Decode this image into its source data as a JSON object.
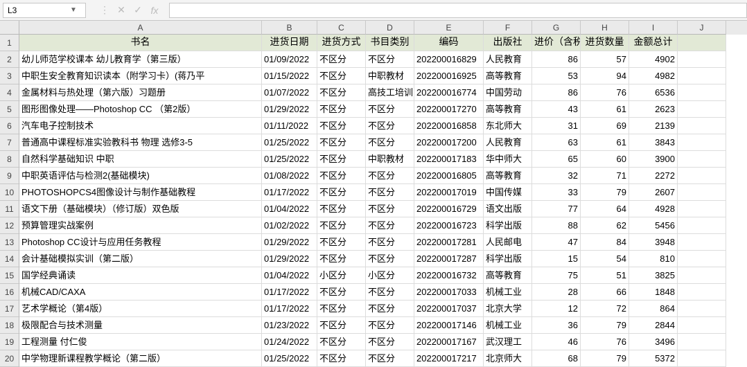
{
  "nameBox": "L3",
  "fxValue": "",
  "columns": [
    "A",
    "B",
    "C",
    "D",
    "E",
    "F",
    "G",
    "H",
    "I",
    "J"
  ],
  "rowNums": [
    "1",
    "2",
    "3",
    "4",
    "5",
    "6",
    "7",
    "8",
    "9",
    "10",
    "11",
    "12",
    "13",
    "14",
    "15",
    "16",
    "17",
    "18",
    "19",
    "20"
  ],
  "headerRow": [
    "书名",
    "进货日期",
    "进货方式",
    "书目类别",
    "编码",
    "出版社",
    "进价（含税）",
    "进货数量",
    "金额总计",
    ""
  ],
  "rows": [
    [
      "幼儿师范学校课本  幼儿教育学（第三版）",
      "01/09/2022",
      "不区分",
      "不区分",
      "202200016829",
      "人民教育",
      "86",
      "57",
      "4902",
      ""
    ],
    [
      "中职生安全教育知识读本（附学习卡）(蒋乃平",
      "01/15/2022",
      "不区分",
      "中职教材",
      "202200016925",
      "高等教育",
      "53",
      "94",
      "4982",
      ""
    ],
    [
      "金属材料与热处理（第六版）习题册",
      "01/07/2022",
      "不区分",
      "高技工培训",
      "202200016774",
      "中国劳动",
      "86",
      "76",
      "6536",
      ""
    ],
    [
      "图形图像处理——Photoshop CC （第2版）",
      "01/29/2022",
      "不区分",
      "不区分",
      "202200017270",
      "高等教育",
      "43",
      "61",
      "2623",
      ""
    ],
    [
      "汽车电子控制技术",
      "01/11/2022",
      "不区分",
      "不区分",
      "202200016858",
      "东北师大",
      "31",
      "69",
      "2139",
      ""
    ],
    [
      "普通高中课程标准实验教科书 物理 选修3-5",
      "01/25/2022",
      "不区分",
      "不区分",
      "202200017200",
      "人民教育",
      "63",
      "61",
      "3843",
      ""
    ],
    [
      "自然科学基础知识  中职",
      "01/25/2022",
      "不区分",
      "中职教材",
      "202200017183",
      "华中师大",
      "65",
      "60",
      "3900",
      ""
    ],
    [
      "中职英语评估与检测2(基础模块)",
      "01/08/2022",
      "不区分",
      "不区分",
      "202200016805",
      "高等教育",
      "32",
      "71",
      "2272",
      ""
    ],
    [
      "PHOTOSHOPCS4图像设计与制作基础教程",
      "01/17/2022",
      "不区分",
      "不区分",
      "202200017019",
      "中国传媒",
      "33",
      "79",
      "2607",
      ""
    ],
    [
      "语文下册（基础模块）（修订版）双色版",
      "01/04/2022",
      "不区分",
      "不区分",
      "202200016729",
      "语文出版",
      "77",
      "64",
      "4928",
      ""
    ],
    [
      "预算管理实战案例",
      "01/02/2022",
      "不区分",
      "不区分",
      "202200016723",
      "科学出版",
      "88",
      "62",
      "5456",
      ""
    ],
    [
      "Photoshop CC设计与应用任务教程",
      "01/29/2022",
      "不区分",
      "不区分",
      "202200017281",
      "人民邮电",
      "47",
      "84",
      "3948",
      ""
    ],
    [
      "会计基础模拟实训（第二版）",
      "01/29/2022",
      "不区分",
      "不区分",
      "202200017287",
      "科学出版",
      "15",
      "54",
      "810",
      ""
    ],
    [
      "国学经典诵读",
      "01/04/2022",
      "小区分",
      "小区分",
      "202200016732",
      "高等教育",
      "75",
      "51",
      "3825",
      ""
    ],
    [
      "机械CAD/CAXA",
      "01/17/2022",
      "不区分",
      "不区分",
      "202200017033",
      "机械工业",
      "28",
      "66",
      "1848",
      ""
    ],
    [
      "艺术学概论（第4版）",
      "01/17/2022",
      "不区分",
      "不区分",
      "202200017037",
      "北京大学",
      "12",
      "72",
      "864",
      ""
    ],
    [
      "极限配合与技术测量",
      "01/23/2022",
      "不区分",
      "不区分",
      "202200017146",
      "机械工业",
      "36",
      "79",
      "2844",
      ""
    ],
    [
      "工程测量  付仁俊",
      "01/24/2022",
      "不区分",
      "不区分",
      "202200017167",
      "武汉理工",
      "46",
      "76",
      "3496",
      ""
    ],
    [
      "中学物理新课程教学概论（第二版）",
      "01/25/2022",
      "不区分",
      "不区分",
      "202200017217",
      "北京师大",
      "68",
      "79",
      "5372",
      ""
    ]
  ],
  "numCols": [
    6,
    7,
    8
  ]
}
